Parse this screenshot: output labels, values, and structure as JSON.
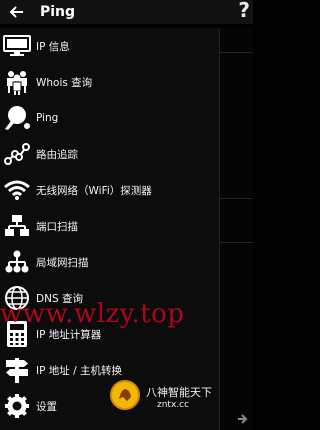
{
  "toolbar": {
    "title": "Ping",
    "help_glyph": "?"
  },
  "menu": [
    {
      "label": "IP 信息",
      "icon": "monitor-icon"
    },
    {
      "label": "Whois 查询",
      "icon": "people-icon"
    },
    {
      "label": "Ping",
      "icon": "ping-pong-icon"
    },
    {
      "label": "路由追踪",
      "icon": "route-icon"
    },
    {
      "label": "无线网络（WiFi）探测器",
      "icon": "wifi-icon"
    },
    {
      "label": "端口扫描",
      "icon": "network-tree-icon"
    },
    {
      "label": "局域网扫描",
      "icon": "lan-scan-icon"
    },
    {
      "label": "DNS 查询",
      "icon": "globe-icon"
    },
    {
      "label": "IP 地址计算器",
      "icon": "calculator-icon"
    },
    {
      "label": "IP 地址 / 主机转换",
      "icon": "signpost-icon"
    },
    {
      "label": "设置",
      "icon": "gear-icon"
    }
  ],
  "watermark": {
    "text": "www.wlzy.top"
  },
  "brand": {
    "name": "八神智能天下",
    "url": "zntx.cc"
  },
  "colors": {
    "accent_watermark": "#c9081c",
    "background": "#000000"
  }
}
